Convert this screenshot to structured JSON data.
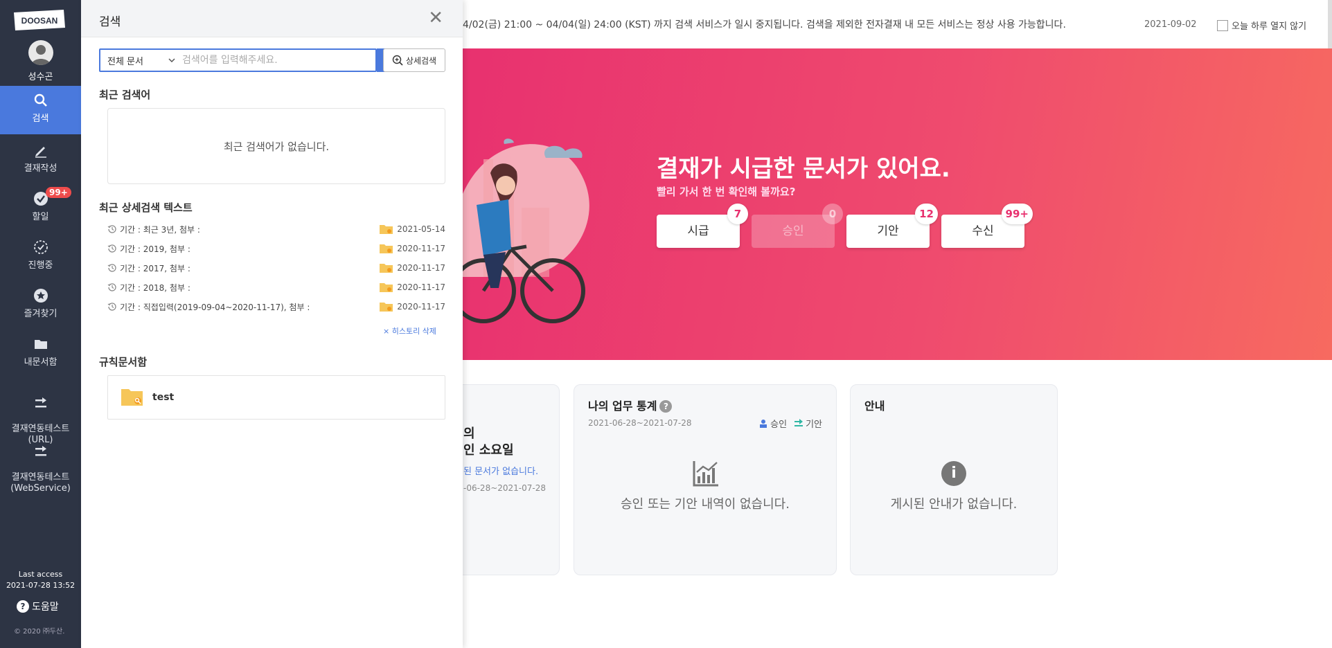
{
  "sidebar": {
    "logo": "DOOSAN",
    "user_name": "성수곤",
    "items": [
      {
        "label": "검색",
        "icon": "search-icon"
      },
      {
        "label": "결재작성",
        "icon": "pencil-icon"
      },
      {
        "label": "할일",
        "icon": "check-circle-icon",
        "badge": "99+"
      },
      {
        "label": "진행중",
        "icon": "progress-icon"
      },
      {
        "label": "즐겨찾기",
        "icon": "star-icon"
      },
      {
        "label": "내문서함",
        "icon": "folder-icon"
      },
      {
        "label": "결재연동테스트\n(URL)",
        "icon": "arrow-icon"
      },
      {
        "label": "결재연동테스트\n(WebService)",
        "icon": "arrow-icon"
      }
    ],
    "last_access_label": "Last access",
    "last_access_time": "2021-07-28 13:52",
    "help_label": "도움말",
    "copyright": "© 2020 ㈜두산."
  },
  "notice": {
    "text": "4/02(금) 21:00 ~ 04/04(일) 24:00 (KST) 까지 검색 서비스가 일시 중지됩니다. 검색을 제외한 전자결재 내 모든 서비스는 정상 사용 가능합니다.",
    "date": "2021-09-02",
    "dismiss_label": "오늘 하루 열지 않기"
  },
  "banner": {
    "title": "결재가 시급한 문서가 있어요.",
    "subtitle": "빨리 가서 한 번 확인해 볼까요?",
    "buttons": [
      {
        "label": "시급",
        "count": "7"
      },
      {
        "label": "승인",
        "count": "0"
      },
      {
        "label": "기안",
        "count": "12"
      },
      {
        "label": "수신",
        "count": "99+"
      }
    ]
  },
  "cards": {
    "partial": {
      "line1": "의",
      "line2": "인 소요일",
      "link": "된 문서가 없습니다.",
      "range": "-06-28~2021-07-28"
    },
    "stats": {
      "title": "나의 업무 통계",
      "range": "2021-06-28~2021-07-28",
      "legend_approve": "승인",
      "legend_draft": "기안",
      "empty": "승인 또는 기안 내역이 없습니다."
    },
    "notice": {
      "title": "안내",
      "empty": "게시된 안내가 없습니다."
    }
  },
  "search_panel": {
    "title": "검색",
    "scope_selected": "전체 문서",
    "placeholder": "검색어를 입력해주세요.",
    "advanced_label": "상세검색",
    "recent_title": "최근 검색어",
    "recent_empty": "최근 검색어가 없습니다.",
    "history_title": "최근 상세검색 텍스트",
    "history": [
      {
        "text": "기간 : 최근 3년, 첨부 :",
        "date": "2021-05-14"
      },
      {
        "text": "기간 : 2019, 첨부 :",
        "date": "2020-11-17"
      },
      {
        "text": "기간 : 2017, 첨부 :",
        "date": "2020-11-17"
      },
      {
        "text": "기간 : 2018, 첨부 :",
        "date": "2020-11-17"
      },
      {
        "text": "기간 : 직접입력(2019-09-04~2020-11-17), 첨부 :",
        "date": "2020-11-17"
      }
    ],
    "delete_history_label": "× 히스토리 삭제",
    "rule_title": "규칙문서함",
    "rule_items": [
      {
        "name": "test"
      }
    ]
  },
  "colors": {
    "sidebar_bg": "#2d3444",
    "accent": "#4a79dd",
    "banner_start": "#e8316f",
    "banner_end": "#f76a60"
  }
}
